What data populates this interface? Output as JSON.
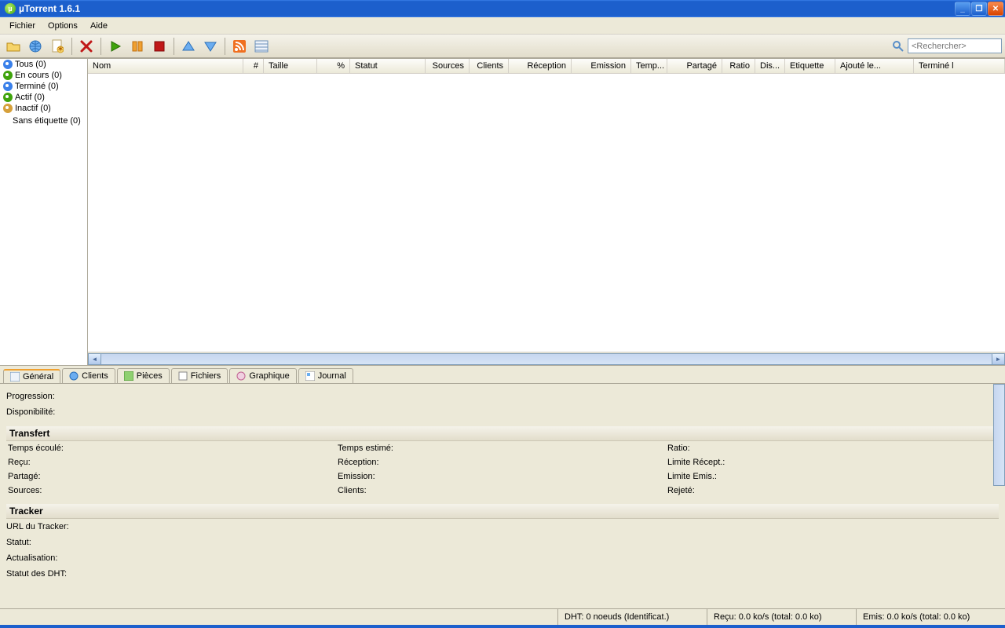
{
  "title": "µTorrent 1.6.1",
  "menu": {
    "file": "Fichier",
    "options": "Options",
    "help": "Aide"
  },
  "search": {
    "placeholder": "<Rechercher>"
  },
  "sidebar": {
    "items": [
      {
        "label": "Tous (0)"
      },
      {
        "label": "En cours (0)"
      },
      {
        "label": "Terminé (0)"
      },
      {
        "label": "Actif (0)"
      },
      {
        "label": "Inactif (0)"
      }
    ],
    "nolabel": "Sans étiquette (0)"
  },
  "columns": {
    "name": "Nom",
    "num": "#",
    "size": "Taille",
    "pct": "%",
    "status": "Statut",
    "sources": "Sources",
    "clients": "Clients",
    "recv": "Réception",
    "send": "Emission",
    "time": "Temp...",
    "shared": "Partagé",
    "ratio": "Ratio",
    "dis": "Dis...",
    "label": "Etiquette",
    "added": "Ajouté le...",
    "done": "Terminé l"
  },
  "tabs": {
    "general": "Général",
    "clients": "Clients",
    "pieces": "Pièces",
    "files": "Fichiers",
    "graph": "Graphique",
    "log": "Journal"
  },
  "general": {
    "progress": "Progression:",
    "avail": "Disponibilité:",
    "transfer_h": "Transfert",
    "elapsed": "Temps écoulé:",
    "eta": "Temps estimé:",
    "ratio": "Ratio:",
    "recv": "Reçu:",
    "recv_rate": "Réception:",
    "recv_limit": "Limite Récept.:",
    "shared": "Partagé:",
    "send_rate": "Emission:",
    "send_limit": "Limite Emis.:",
    "sources": "Sources:",
    "clients": "Clients:",
    "rejected": "Rejeté:",
    "tracker_h": "Tracker",
    "turl": "URL du Tracker:",
    "tstatus": "Statut:",
    "tupdate": "Actualisation:",
    "dhtstatus": "Statut des DHT:"
  },
  "status": {
    "dht": "DHT: 0 noeuds (Identificat.)",
    "recv": "Reçu: 0.0 ko/s  (total: 0.0 ko)",
    "sent": "Emis: 0.0 ko/s  (total: 0.0 ko)"
  }
}
